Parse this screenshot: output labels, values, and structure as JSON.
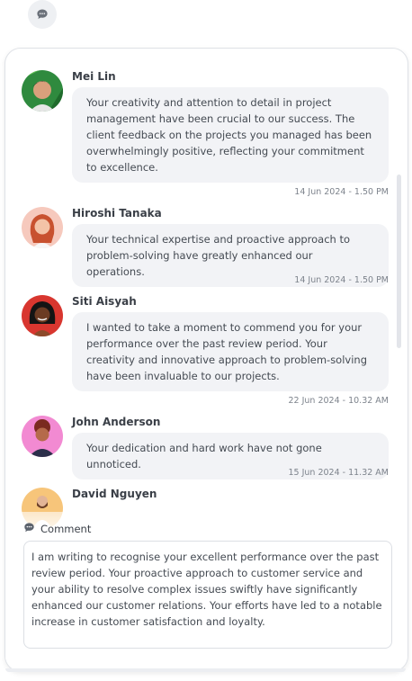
{
  "top_icon": "chat-bubble-icon",
  "messages": [
    {
      "name": "Mei Lin",
      "text": "Your creativity and attention to detail in project management have been crucial to our success. The client feedback on the projects you managed has been overwhelmingly positive, reflecting your commitment to excellence.",
      "time": "14 Jun 2024 - 1.50 PM"
    },
    {
      "name": "Hiroshi Tanaka",
      "text": "Your technical expertise and proactive approach to problem-solving have greatly enhanced our operations.",
      "time": "14 Jun 2024 - 1.50 PM"
    },
    {
      "name": "Siti Aisyah",
      "text": "I wanted to take a moment to commend you for your performance over the past review period. Your creativity and innovative approach to problem-solving have been invaluable to our projects.",
      "time": "22 Jun 2024 - 10.32 AM"
    },
    {
      "name": "John Anderson",
      "text": "Your dedication and hard work have not gone unnoticed.",
      "time": "15 Jun 2024 - 11.32 AM"
    },
    {
      "name": "David Nguyen",
      "text": "",
      "time": ""
    }
  ],
  "comment": {
    "label": "Comment",
    "icon": "comment-icon",
    "value": "I am writing to recognise your excellent performance over the past review period. Your proactive approach to customer service and your ability to resolve complex issues swiftly have significantly enhanced our customer relations. Your efforts have led to a notable increase in customer satisfaction and loyalty."
  }
}
